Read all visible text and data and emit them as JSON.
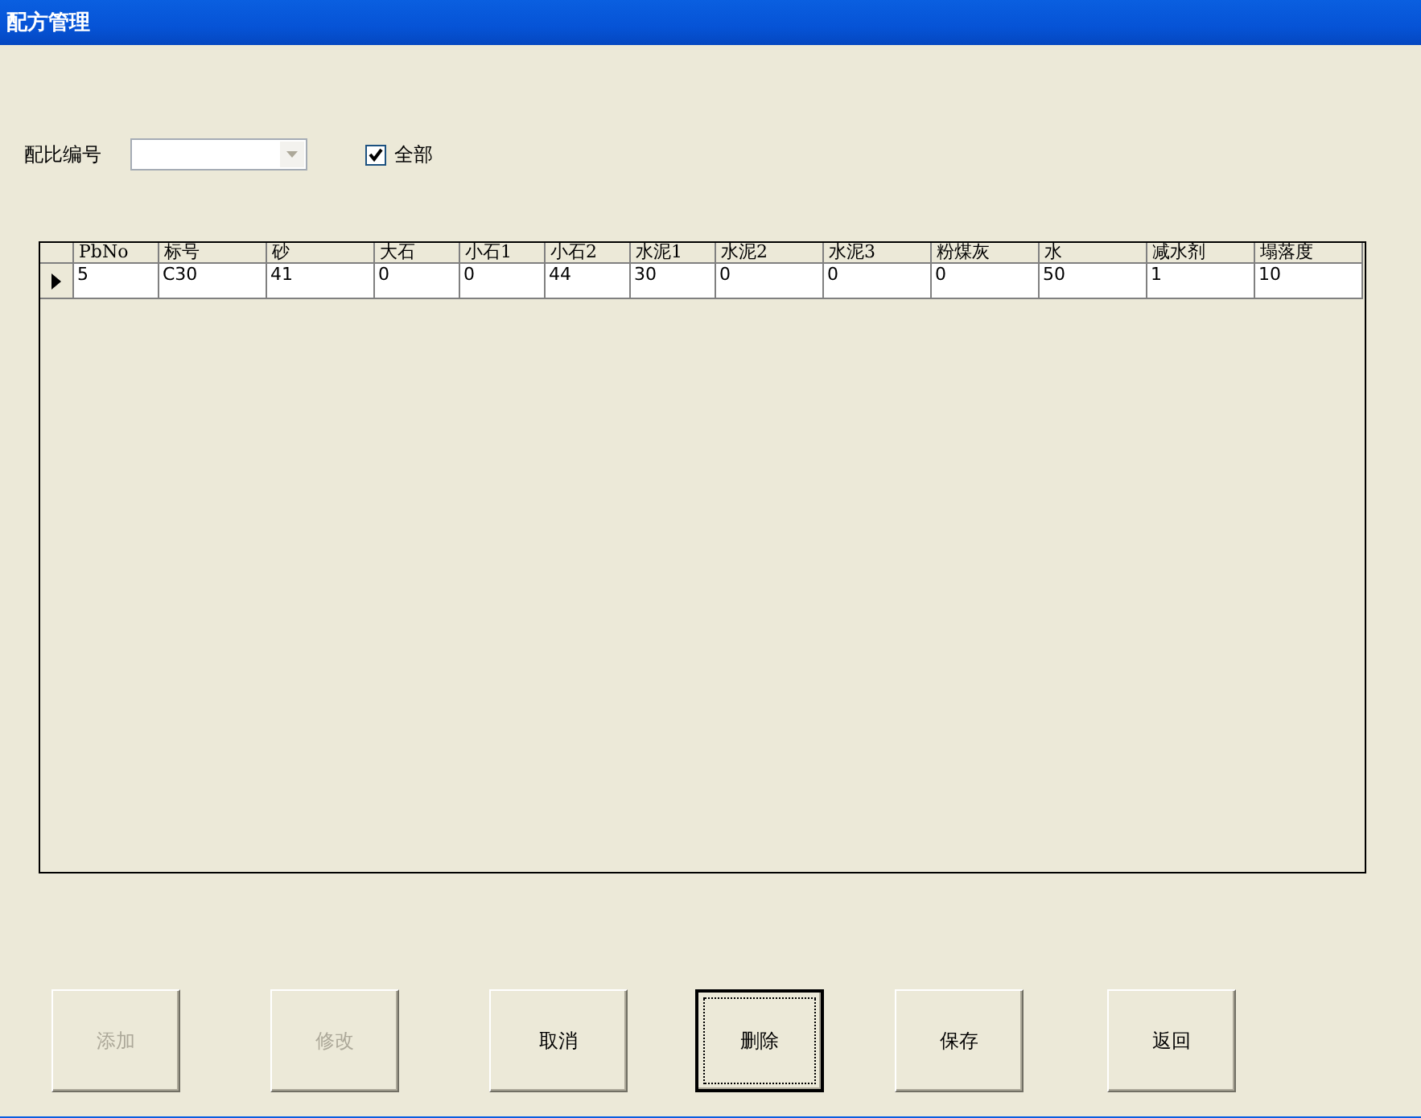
{
  "window": {
    "title": "配方管理"
  },
  "filter": {
    "label": "配比编号",
    "all_checkbox": {
      "label": "全部",
      "checked": true
    }
  },
  "table": {
    "columns": [
      "PbNo",
      "标号",
      "砂",
      "大石",
      "小石1",
      "小石2",
      "水泥1",
      "水泥2",
      "水泥3",
      "粉煤灰",
      "水",
      "减水剂",
      "塌落度"
    ],
    "rows": [
      {
        "selected": true,
        "cells": [
          "5",
          "C30",
          "41",
          "0",
          "0",
          "44",
          "30",
          "0",
          "0",
          "0",
          "50",
          "1",
          "10"
        ]
      }
    ]
  },
  "buttons": [
    {
      "label": "添加",
      "disabled": true,
      "focused": false
    },
    {
      "label": "修改",
      "disabled": true,
      "focused": false
    },
    {
      "label": "取消",
      "disabled": false,
      "focused": false
    },
    {
      "label": "删除",
      "disabled": false,
      "focused": true
    },
    {
      "label": "保存",
      "disabled": false,
      "focused": false
    },
    {
      "label": "返回",
      "disabled": false,
      "focused": false
    }
  ]
}
